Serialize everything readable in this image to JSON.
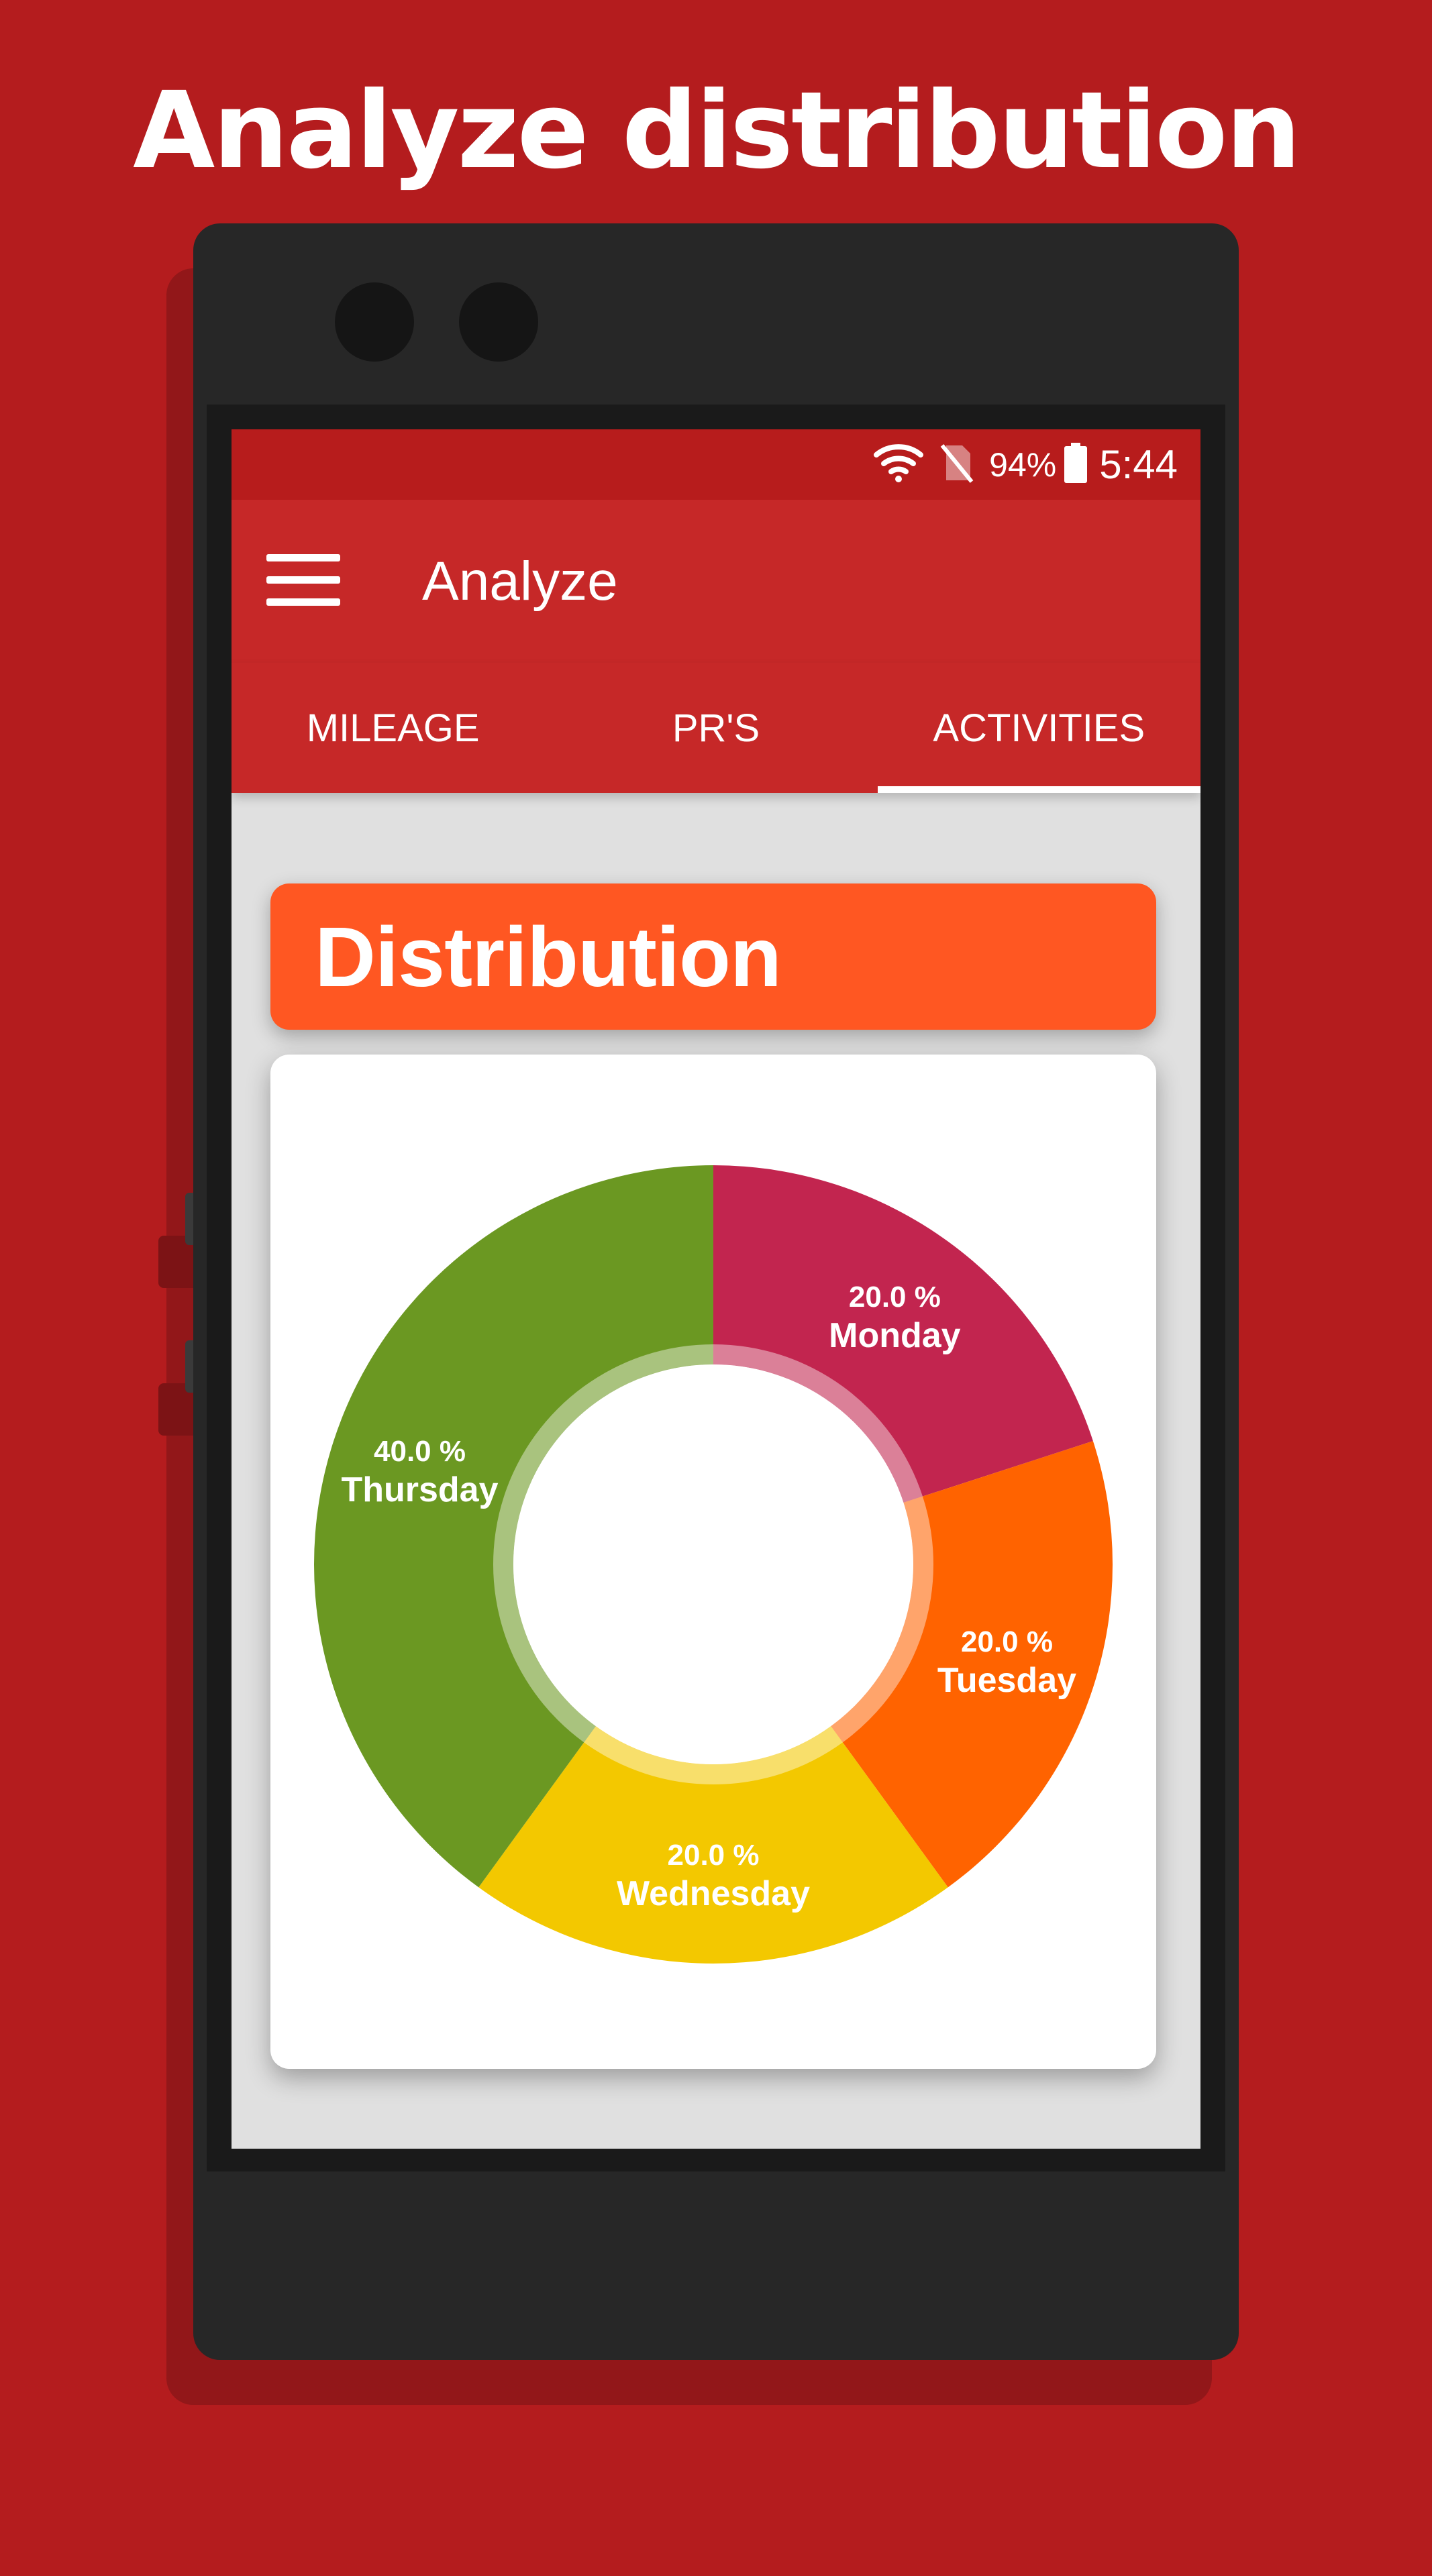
{
  "promo": {
    "headline": "Analyze distribution"
  },
  "status_bar": {
    "battery_percent": "94%",
    "time": "5:44"
  },
  "toolbar": {
    "title": "Analyze"
  },
  "tabs": [
    {
      "label": "MILEAGE",
      "active": false
    },
    {
      "label": "PR'S",
      "active": false
    },
    {
      "label": "ACTIVITIES",
      "active": true
    }
  ],
  "section": {
    "title": "Distribution"
  },
  "colors": {
    "background": "#b41c1e",
    "toolbar": "#c62828",
    "status_bar": "#b71c1c",
    "section_header": "#ff5722"
  },
  "chart_data": {
    "type": "pie",
    "variant": "donut",
    "categories": [
      "Monday",
      "Tuesday",
      "Wednesday",
      "Thursday"
    ],
    "values": [
      20.0,
      20.0,
      20.0,
      40.0
    ],
    "value_labels": [
      "20.0 %",
      "20.0 %",
      "20.0 %",
      "40.0 %"
    ],
    "colors": [
      "#c2254f",
      "#ff6300",
      "#f3c800",
      "#6b9822"
    ],
    "start_angle_deg": 0,
    "direction": "clockwise"
  }
}
